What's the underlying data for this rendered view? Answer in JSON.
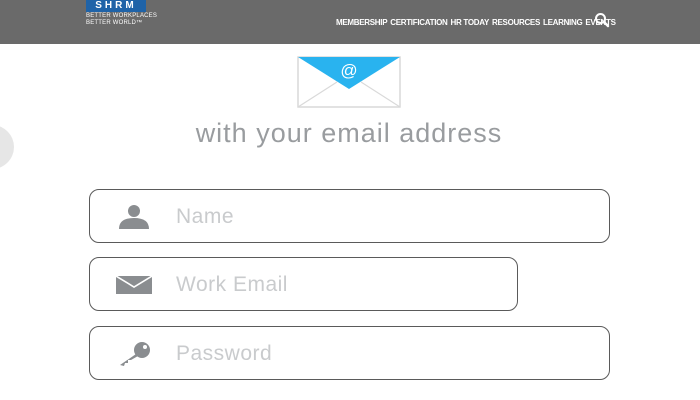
{
  "header": {
    "logo": {
      "text": "SHRM",
      "tagline_line1": "BETTER WORKPLACES",
      "tagline_line2": "BETTER WORLD™"
    },
    "nav": [
      "MEMBERSHIP",
      "CERTIFICATION",
      "HR TODAY",
      "RESOURCES",
      "LEARNING",
      "EVENTS"
    ],
    "search_icon": "search-icon",
    "background_color": "#6a6a6a"
  },
  "main": {
    "icon": "email-envelope-icon",
    "heading": "with your email address",
    "accent_color": "#29b3ef",
    "fields": {
      "name": {
        "placeholder": "Name",
        "icon": "user-icon",
        "value": ""
      },
      "email": {
        "placeholder": "Work Email",
        "icon": "mail-icon",
        "value": ""
      },
      "password": {
        "placeholder": "Password",
        "icon": "key-icon",
        "value": ""
      }
    }
  }
}
